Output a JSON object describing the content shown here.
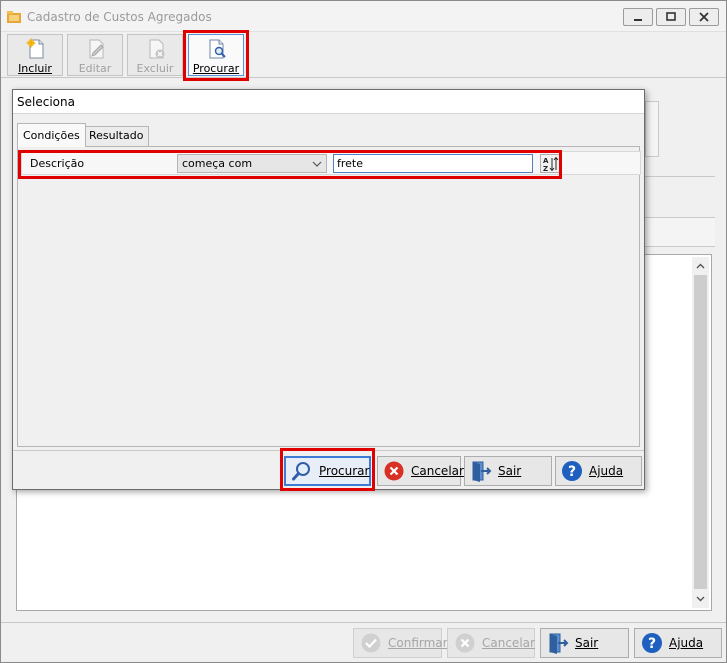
{
  "window": {
    "title": "Cadastro de Custos Agregados"
  },
  "toolbar": {
    "incluir": "Incluir",
    "editar": "Editar",
    "excluir": "Excluir",
    "procurar": "Procurar"
  },
  "dialog": {
    "title": "Seleciona",
    "tabs": [
      "Condições",
      "Resultado"
    ],
    "condition": {
      "field": "Descrição",
      "operator": "começa com",
      "value": "frete"
    },
    "buttons": {
      "procurar": "Procurar",
      "cancelar": "Cancelar",
      "sair": "Sair",
      "ajuda": "Ajuda"
    }
  },
  "bottom": {
    "confirmar": "Confirmar",
    "cancelar": "Cancelar",
    "sair": "Sair",
    "ajuda": "Ajuda"
  },
  "colors": {
    "highlight_frame": "#e00000",
    "focus_blue": "#3d7bd4",
    "cancel_red": "#d93025",
    "help_blue": "#1f5fbf"
  }
}
